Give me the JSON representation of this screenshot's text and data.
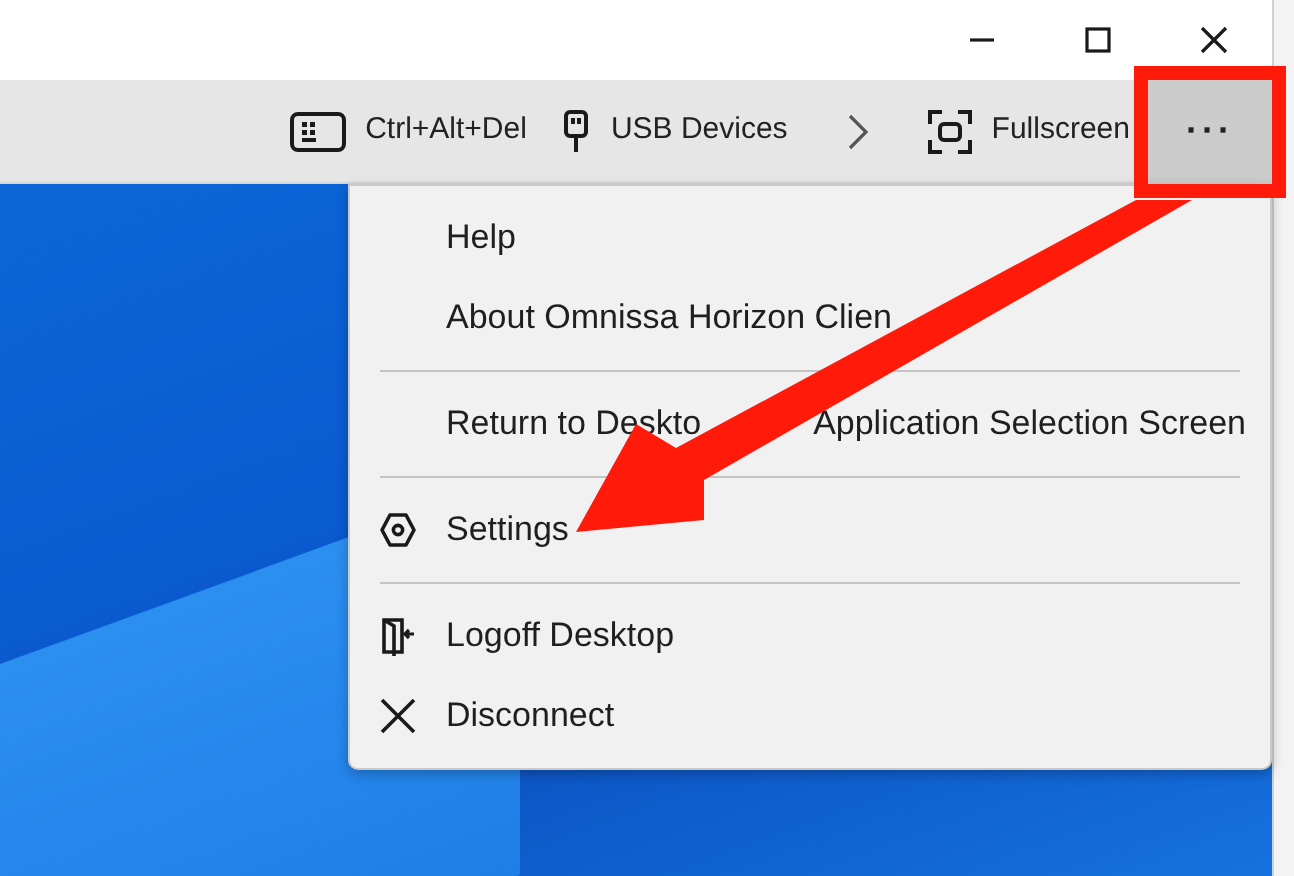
{
  "window": {
    "controls": [
      {
        "kind": "minimize"
      },
      {
        "kind": "maximize"
      },
      {
        "kind": "close"
      }
    ]
  },
  "toolbar": {
    "items": [
      {
        "kind": "keyboard",
        "label": "Ctrl+Alt+Del"
      },
      {
        "kind": "usb",
        "label": "USB Devices"
      },
      {
        "kind": "chevron"
      },
      {
        "kind": "fullscreen",
        "label": "Fullscreen"
      },
      {
        "kind": "more",
        "label": "···",
        "selected": true
      }
    ]
  },
  "menu": {
    "items": [
      {
        "kind": "item",
        "label": "Help"
      },
      {
        "kind": "item",
        "label": "About Omnissa Horizon Clien"
      },
      {
        "kind": "separator"
      },
      {
        "kind": "item",
        "parts": [
          "Return to Deskto",
          "Application Selection Screen"
        ]
      },
      {
        "kind": "separator"
      },
      {
        "kind": "settings",
        "label": "Settings"
      },
      {
        "kind": "separator"
      },
      {
        "kind": "logoff",
        "label": "Logoff Desktop"
      },
      {
        "kind": "disconnect",
        "label": "Disconnect"
      }
    ]
  },
  "annotations": {
    "highlight_box": true,
    "arrow": true
  }
}
